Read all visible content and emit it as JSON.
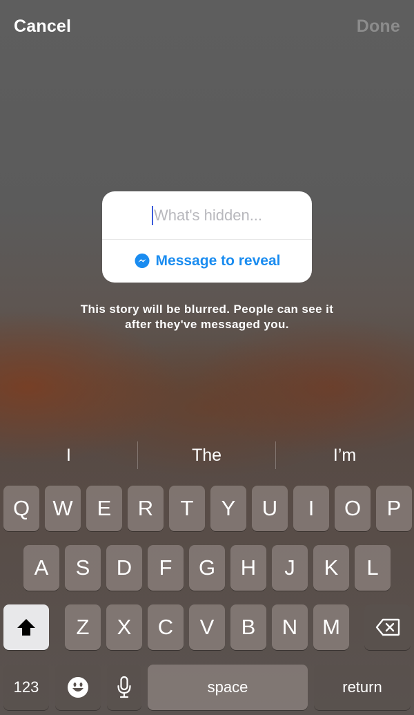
{
  "header": {
    "cancel_label": "Cancel",
    "done_label": "Done"
  },
  "card": {
    "input_placeholder": "What's hidden...",
    "reveal_label": "Message to reveal",
    "reveal_icon": "messenger-icon"
  },
  "hint": {
    "line1": "This story will be blurred. People can see it",
    "line2": "after they've messaged you."
  },
  "keyboard": {
    "suggestions": [
      "I",
      "The",
      "I’m"
    ],
    "row1": [
      "Q",
      "W",
      "E",
      "R",
      "T",
      "Y",
      "U",
      "I",
      "O",
      "P"
    ],
    "row2": [
      "A",
      "S",
      "D",
      "F",
      "G",
      "H",
      "J",
      "K",
      "L"
    ],
    "row3": [
      "Z",
      "X",
      "C",
      "V",
      "B",
      "N",
      "M"
    ],
    "shift_icon": "shift-icon",
    "delete_icon": "backspace-icon",
    "numbers_label": "123",
    "emoji_icon": "emoji-icon",
    "mic_icon": "microphone-icon",
    "space_label": "space",
    "return_label": "return"
  },
  "colors": {
    "accent": "#1a8cf0",
    "caret": "#3b5bdb",
    "done_disabled": "#8c8c8c"
  }
}
